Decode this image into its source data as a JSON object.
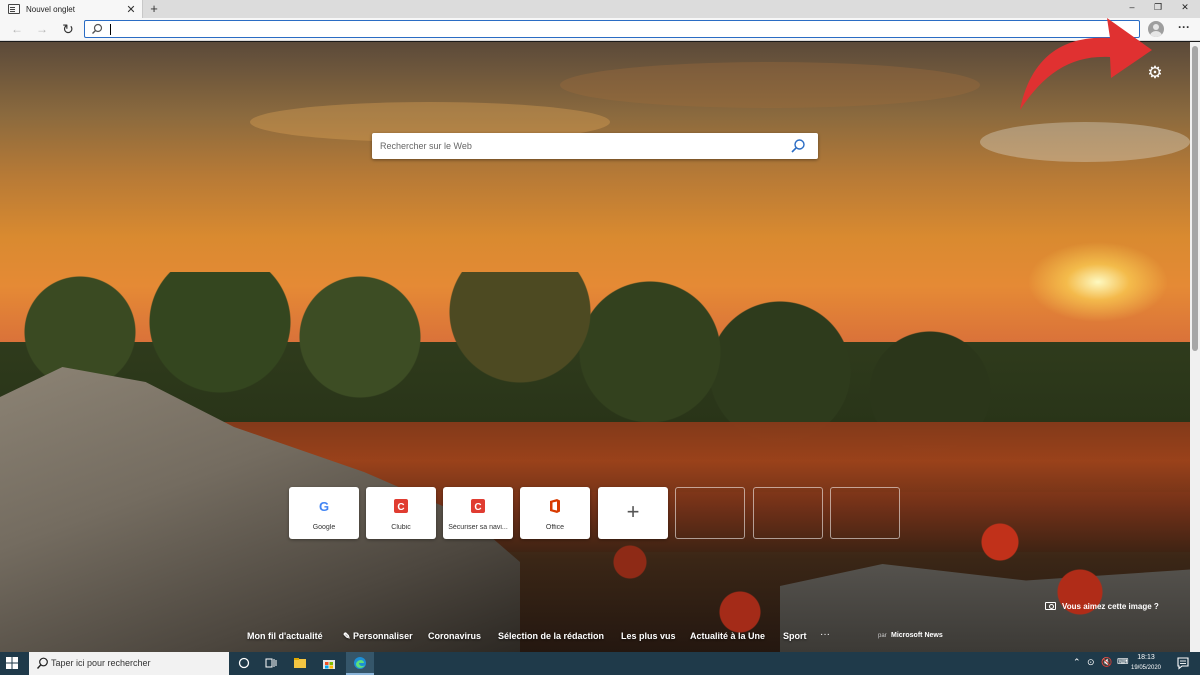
{
  "browser": {
    "tab_title": "Nouvel onglet",
    "tab_close": "✕",
    "new_tab": "+",
    "window_controls": {
      "minimize": "–",
      "restore": "❐",
      "close": "✕"
    },
    "nav": {
      "back": "←",
      "forward": "→",
      "refresh": "↻"
    },
    "address_value": "",
    "more": "···"
  },
  "page": {
    "search_placeholder": "Rechercher sur le Web",
    "settings_icon": "gear-icon",
    "quick_links": [
      {
        "label": "Google",
        "icon": "google-icon"
      },
      {
        "label": "Clubic",
        "icon": "clubic-icon"
      },
      {
        "label": "Sécuriser sa navi...",
        "icon": "clubic-icon"
      },
      {
        "label": "Office",
        "icon": "office-icon"
      }
    ],
    "add_tile": "+",
    "photo_credit": "Vous aimez cette image ?",
    "news": {
      "links": [
        "Mon fil d'actualité",
        "Personnaliser",
        "Coronavirus",
        "Sélection de la rédaction",
        "Les plus vus",
        "Actualité à la Une",
        "Sport"
      ],
      "more": "···",
      "by": "par",
      "source": "Microsoft News"
    }
  },
  "taskbar": {
    "search_placeholder": "Taper ici pour rechercher",
    "time": "18:13",
    "date": "19/05/2020"
  },
  "colors": {
    "accent": "#2a6cc4",
    "annotation_arrow": "#e03131",
    "taskbar": "#1f3a4a"
  }
}
